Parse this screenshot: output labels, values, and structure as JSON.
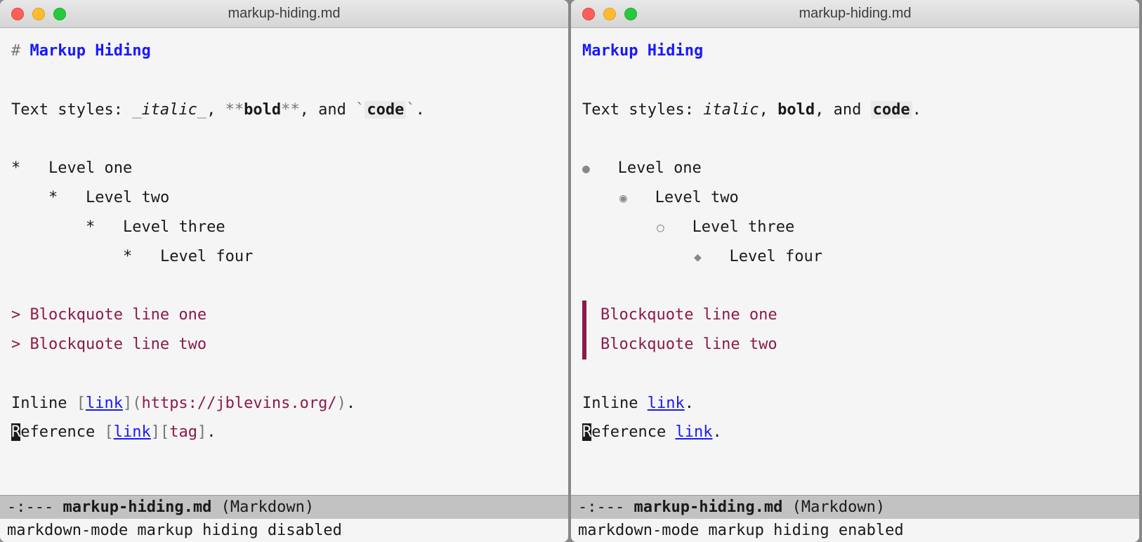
{
  "left": {
    "title": "markup-hiding.md",
    "heading_marker": "# ",
    "heading": "Markup Hiding",
    "text_styles_prefix": "Text styles: ",
    "italic_marker": "_",
    "italic": "italic",
    "bold_marker": "**",
    "bold": "bold",
    "code_marker": "`",
    "code": "code",
    "text_styles_sep1": ", ",
    "text_styles_sep2": ", and ",
    "text_styles_end": ".",
    "list": [
      {
        "indent": "",
        "marker": "*",
        "pad": "   ",
        "text": "Level one"
      },
      {
        "indent": "    ",
        "marker": "*",
        "pad": "   ",
        "text": "Level two"
      },
      {
        "indent": "        ",
        "marker": "*",
        "pad": "   ",
        "text": "Level three"
      },
      {
        "indent": "            ",
        "marker": "*",
        "pad": "   ",
        "text": "Level four"
      }
    ],
    "bq_marker": "> ",
    "bq1": "Blockquote line one",
    "bq2": "Blockquote line two",
    "inline_prefix": "Inline ",
    "inline_link": "link",
    "inline_url": "https://jblevins.org/",
    "inline_end": ".",
    "ref_prefix_first": "R",
    "ref_prefix_rest": "eference ",
    "ref_link": "link",
    "ref_tag": "tag",
    "ref_end": ".",
    "modeline_prefix": "-:--- ",
    "modeline_file": "markup-hiding.md",
    "modeline_mode": "   (Markdown)",
    "echo": "markdown-mode markup hiding disabled"
  },
  "right": {
    "title": "markup-hiding.md",
    "heading": "Markup Hiding",
    "text_styles_prefix": "Text styles: ",
    "italic": "italic",
    "bold": "bold",
    "code": "code",
    "text_styles_sep1": ", ",
    "text_styles_sep2": ", and ",
    "text_styles_end": ".",
    "list": [
      {
        "indent": "",
        "bullet": "●",
        "pad": "   ",
        "text": "Level one"
      },
      {
        "indent": "    ",
        "bullet": "◉",
        "pad": "   ",
        "text": "Level two"
      },
      {
        "indent": "        ",
        "bullet": "○",
        "pad": "   ",
        "text": "Level three"
      },
      {
        "indent": "            ",
        "bullet": "◆",
        "pad": "   ",
        "text": "Level four"
      }
    ],
    "bq1": "Blockquote line one",
    "bq2": "Blockquote line two",
    "inline_prefix": "Inline ",
    "inline_link": "link",
    "inline_end": ".",
    "ref_prefix_first": "R",
    "ref_prefix_rest": "eference ",
    "ref_link": "link",
    "ref_end": ".",
    "modeline_prefix": "-:--- ",
    "modeline_file": "markup-hiding.md",
    "modeline_mode": "   (Markdown)",
    "echo": "markdown-mode markup hiding enabled"
  }
}
